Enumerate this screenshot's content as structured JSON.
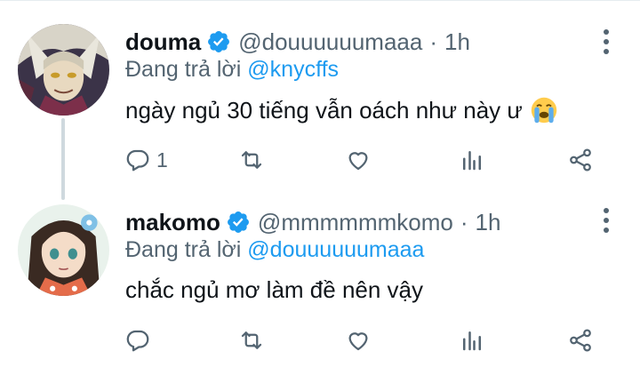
{
  "tweets": [
    {
      "name": "douma",
      "handle": "@douuuuuumaaa",
      "separator": "·",
      "time": "1h",
      "reply_prefix": "Đang trả lời",
      "reply_to": "@knycffs",
      "text": "ngày ngủ 30 tiếng vẫn oách như này ư",
      "emoji": "loudly-crying-face",
      "reply_count": "1"
    },
    {
      "name": "makomo",
      "handle": "@mmmmmmkomo",
      "separator": "·",
      "time": "1h",
      "reply_prefix": "Đang trả lời",
      "reply_to": "@douuuuuumaaa",
      "text": "chắc ngủ mơ làm đề nên vậy",
      "reply_count": ""
    }
  ],
  "colors": {
    "accent": "#1d9bf0",
    "secondary_text": "#536471",
    "primary_text": "#0f1419",
    "thread_line": "#cfd9de"
  }
}
